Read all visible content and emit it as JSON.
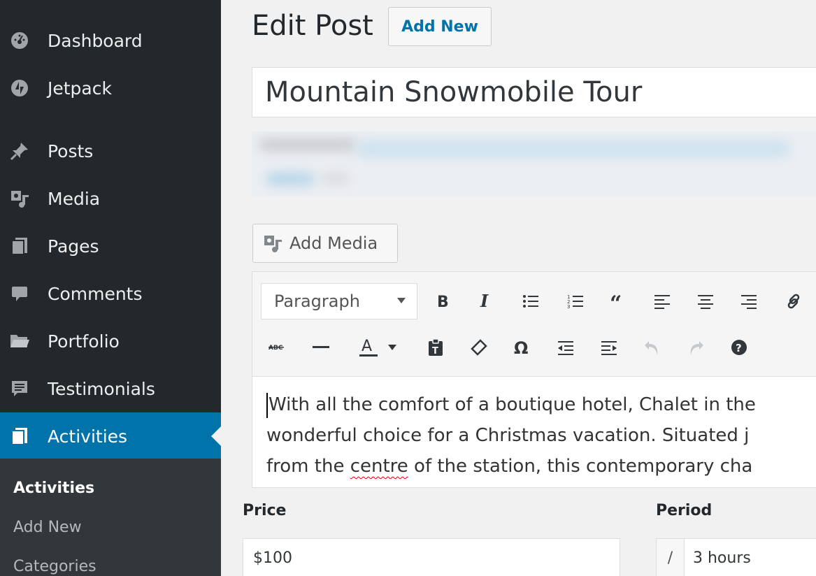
{
  "sidebar": {
    "items": [
      {
        "label": "Dashboard",
        "icon": "dashboard-icon"
      },
      {
        "label": "Jetpack",
        "icon": "jetpack-icon"
      },
      {
        "label": "Posts",
        "icon": "pin-icon"
      },
      {
        "label": "Media",
        "icon": "media-icon"
      },
      {
        "label": "Pages",
        "icon": "pages-icon"
      },
      {
        "label": "Comments",
        "icon": "comment-icon"
      },
      {
        "label": "Portfolio",
        "icon": "folder-icon"
      },
      {
        "label": "Testimonials",
        "icon": "testimonial-icon"
      },
      {
        "label": "Activities",
        "icon": "activities-icon",
        "active": true
      }
    ],
    "submenu": [
      "Activities",
      "Add New",
      "Categories"
    ]
  },
  "header": {
    "title": "Edit Post",
    "add_new_label": "Add New"
  },
  "post": {
    "title": "Mountain Snowmobile Tour"
  },
  "editor": {
    "add_media_label": "Add Media",
    "format_value": "Paragraph",
    "content_lines": [
      "With all the comfort of a boutique hotel, Chalet in the",
      "wonderful choice for a Christmas vacation. Situated j",
      "from the centre of the station, this contemporary cha"
    ],
    "line3_pre": "from the ",
    "line3_spell": "centre",
    "line3_post": " of the station, this contemporary cha"
  },
  "fields": {
    "price_label": "Price",
    "price_value": "$100",
    "period_label": "Period",
    "period_prefix": "/",
    "period_value": "3 hours"
  },
  "colors": {
    "sidebar_bg": "#23282d",
    "accent": "#0073aa"
  }
}
